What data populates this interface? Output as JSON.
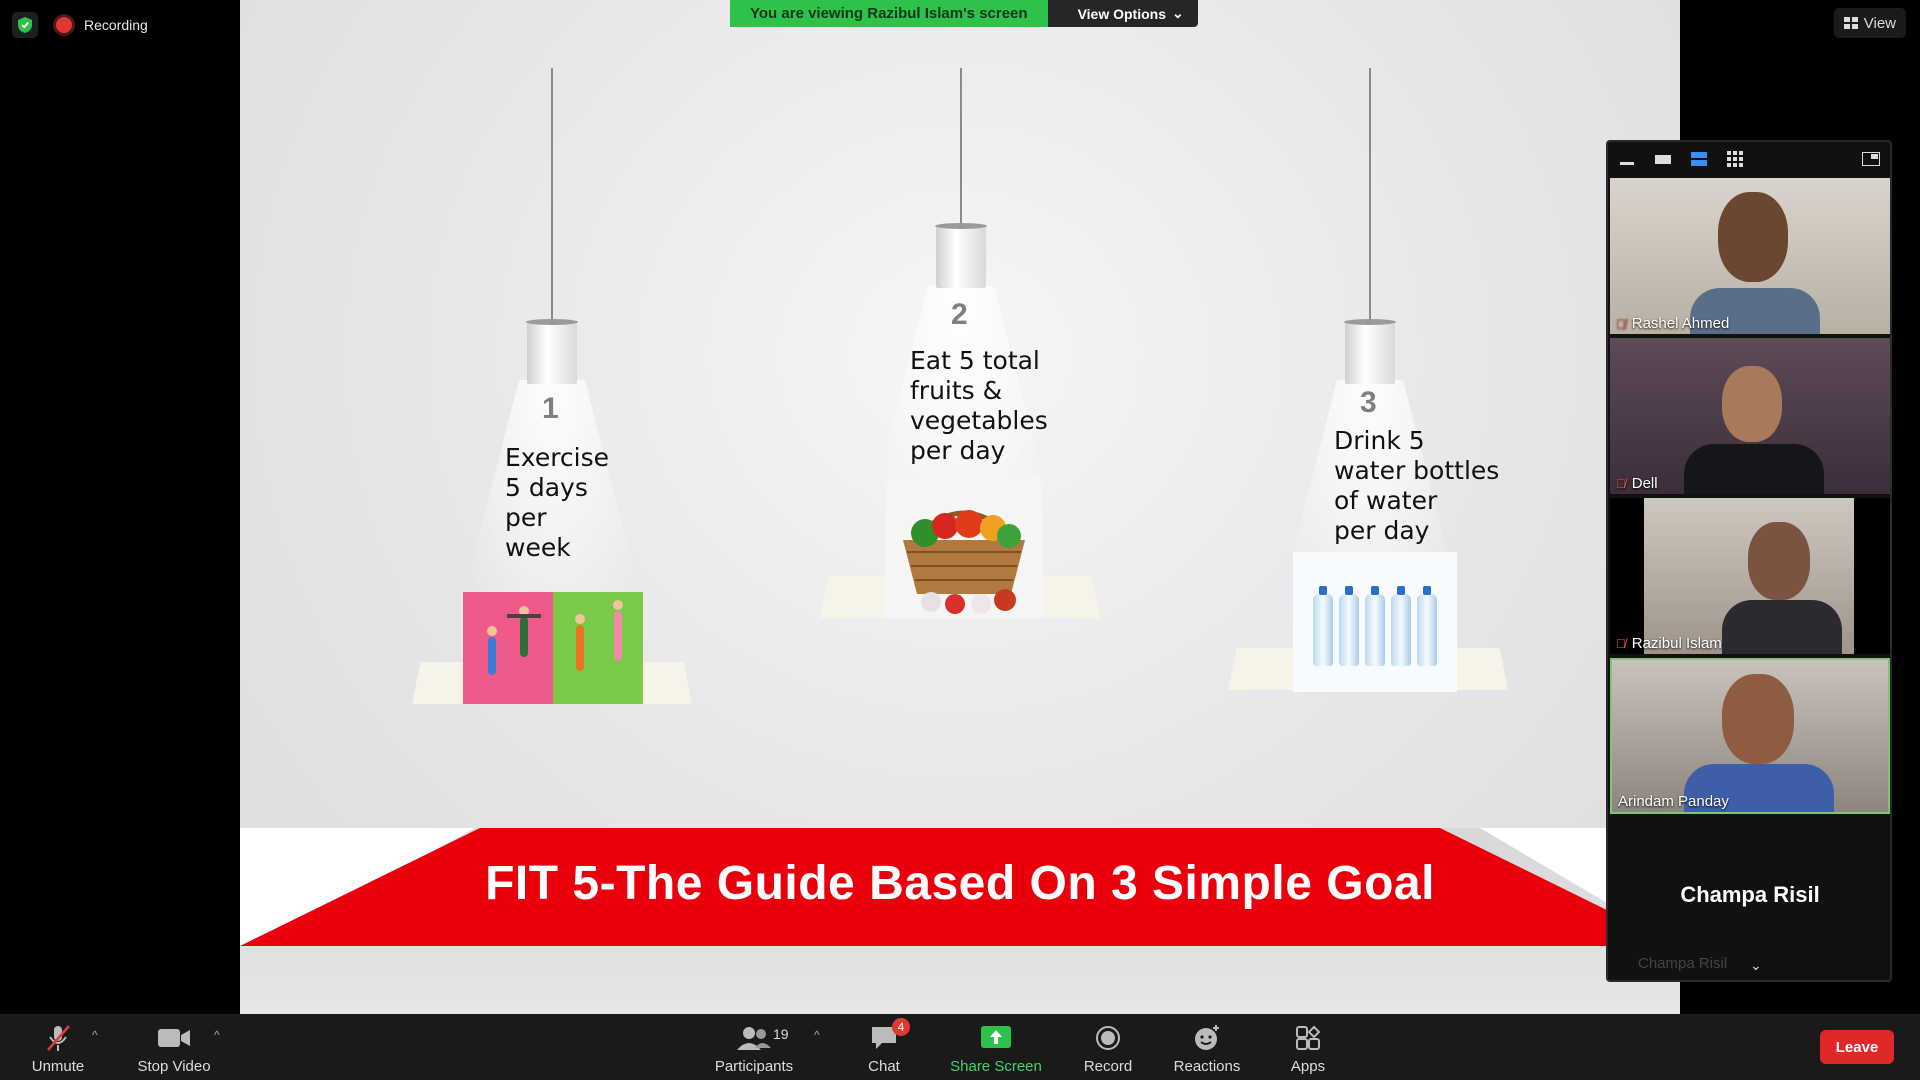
{
  "status": {
    "recording_label": "Recording",
    "view_label": "View"
  },
  "share_banner": {
    "viewing_text": "You are viewing Razibul Islam's screen",
    "view_options_label": "View Options"
  },
  "slide": {
    "goals": [
      {
        "number": "1",
        "text": "Exercise\n5 days\nper\nweek"
      },
      {
        "number": "2",
        "text": "Eat 5 total\nfruits &\nvegetables\nper day"
      },
      {
        "number": "3",
        "text": "Drink 5\nwater bottles\nof water\nper day"
      }
    ],
    "title": "FIT 5-The Guide Based On 3 Simple Goal"
  },
  "gallery": {
    "participants": [
      {
        "name": "Rashel Ahmed",
        "muted": true
      },
      {
        "name": "Dell",
        "muted": true
      },
      {
        "name": "Razibul Islam",
        "muted": true
      },
      {
        "name": "Arindam Panday",
        "muted": false,
        "active_speaker": true
      }
    ],
    "no_video_participant": {
      "name": "Champa Risil"
    }
  },
  "toolbar": {
    "unmute_label": "Unmute",
    "stop_video_label": "Stop Video",
    "participants_label": "Participants",
    "participants_count": "19",
    "chat_label": "Chat",
    "chat_badge": "4",
    "share_screen_label": "Share Screen",
    "record_label": "Record",
    "reactions_label": "Reactions",
    "apps_label": "Apps",
    "leave_label": "Leave"
  },
  "colors": {
    "share_green": "#2ec24b",
    "slide_red": "#e9000c",
    "leave_red": "#e02828",
    "active_speaker_border": "#7ec76f"
  }
}
